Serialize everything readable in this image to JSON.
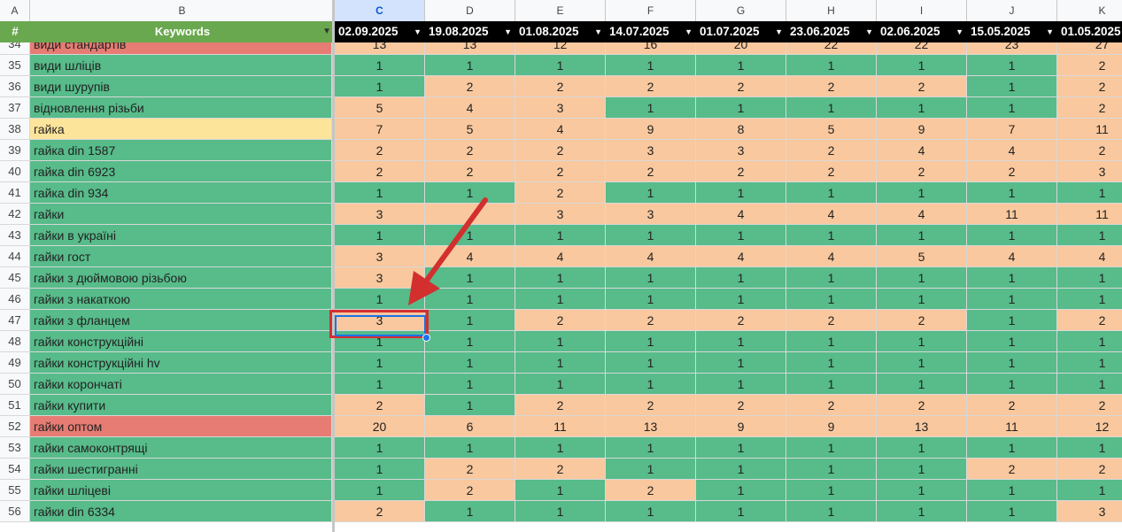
{
  "columns_letters": [
    "A",
    "B",
    "C",
    "D",
    "E",
    "F",
    "G",
    "H",
    "I",
    "J",
    "K"
  ],
  "header": {
    "hash": "#",
    "keywords": "Keywords",
    "dates": [
      "02.09.2025",
      "19.08.2025",
      "01.08.2025",
      "14.07.2025",
      "01.07.2025",
      "23.06.2025",
      "02.06.2025",
      "15.05.2025",
      "01.05.2025"
    ]
  },
  "rows": [
    {
      "n": "34",
      "kw": "види стандартів",
      "kwc": "r",
      "v": [
        "13",
        "13",
        "12",
        "16",
        "20",
        "22",
        "22",
        "23",
        "27"
      ],
      "c": [
        "o",
        "o",
        "o",
        "o",
        "o",
        "o",
        "o",
        "o",
        "o"
      ]
    },
    {
      "n": "35",
      "kw": "види шліців",
      "kwc": "g",
      "v": [
        "1",
        "1",
        "1",
        "1",
        "1",
        "1",
        "1",
        "1",
        "2"
      ],
      "c": [
        "g",
        "g",
        "g",
        "g",
        "g",
        "g",
        "g",
        "g",
        "o"
      ]
    },
    {
      "n": "36",
      "kw": "види шурупів",
      "kwc": "g",
      "v": [
        "1",
        "2",
        "2",
        "2",
        "2",
        "2",
        "2",
        "1",
        "2"
      ],
      "c": [
        "g",
        "o",
        "o",
        "o",
        "o",
        "o",
        "o",
        "g",
        "o"
      ]
    },
    {
      "n": "37",
      "kw": "відновлення різьби",
      "kwc": "g",
      "v": [
        "5",
        "4",
        "3",
        "1",
        "1",
        "1",
        "1",
        "1",
        "2"
      ],
      "c": [
        "o",
        "o",
        "o",
        "g",
        "g",
        "g",
        "g",
        "g",
        "o"
      ]
    },
    {
      "n": "38",
      "kw": "гайка",
      "kwc": "y",
      "v": [
        "7",
        "5",
        "4",
        "9",
        "8",
        "5",
        "9",
        "7",
        "11"
      ],
      "c": [
        "o",
        "o",
        "o",
        "o",
        "o",
        "o",
        "o",
        "o",
        "o"
      ]
    },
    {
      "n": "39",
      "kw": "гайка din 1587",
      "kwc": "g",
      "v": [
        "2",
        "2",
        "2",
        "3",
        "3",
        "2",
        "4",
        "4",
        "2"
      ],
      "c": [
        "o",
        "o",
        "o",
        "o",
        "o",
        "o",
        "o",
        "o",
        "o"
      ]
    },
    {
      "n": "40",
      "kw": "гайка din 6923",
      "kwc": "g",
      "v": [
        "2",
        "2",
        "2",
        "2",
        "2",
        "2",
        "2",
        "2",
        "3"
      ],
      "c": [
        "o",
        "o",
        "o",
        "o",
        "o",
        "o",
        "o",
        "o",
        "o"
      ]
    },
    {
      "n": "41",
      "kw": "гайка din 934",
      "kwc": "g",
      "v": [
        "1",
        "1",
        "2",
        "1",
        "1",
        "1",
        "1",
        "1",
        "1"
      ],
      "c": [
        "g",
        "g",
        "o",
        "g",
        "g",
        "g",
        "g",
        "g",
        "g"
      ]
    },
    {
      "n": "42",
      "kw": "гайки",
      "kwc": "g",
      "v": [
        "3",
        "",
        "3",
        "3",
        "4",
        "4",
        "4",
        "11",
        "11"
      ],
      "c": [
        "o",
        "o",
        "o",
        "o",
        "o",
        "o",
        "o",
        "o",
        "o"
      ]
    },
    {
      "n": "43",
      "kw": "гайки в україні",
      "kwc": "g",
      "v": [
        "1",
        "1",
        "1",
        "1",
        "1",
        "1",
        "1",
        "1",
        "1"
      ],
      "c": [
        "g",
        "g",
        "g",
        "g",
        "g",
        "g",
        "g",
        "g",
        "g"
      ]
    },
    {
      "n": "44",
      "kw": "гайки гост",
      "kwc": "g",
      "v": [
        "3",
        "4",
        "4",
        "4",
        "4",
        "4",
        "5",
        "4",
        "4"
      ],
      "c": [
        "o",
        "o",
        "o",
        "o",
        "o",
        "o",
        "o",
        "o",
        "o"
      ]
    },
    {
      "n": "45",
      "kw": "гайки з дюймовою різьбою",
      "kwc": "g",
      "v": [
        "3",
        "1",
        "1",
        "1",
        "1",
        "1",
        "1",
        "1",
        "1"
      ],
      "c": [
        "o",
        "g",
        "g",
        "g",
        "g",
        "g",
        "g",
        "g",
        "g"
      ]
    },
    {
      "n": "46",
      "kw": "гайки з накаткою",
      "kwc": "g",
      "v": [
        "1",
        "1",
        "1",
        "1",
        "1",
        "1",
        "1",
        "1",
        "1"
      ],
      "c": [
        "g",
        "g",
        "g",
        "g",
        "g",
        "g",
        "g",
        "g",
        "g"
      ]
    },
    {
      "n": "47",
      "kw": "гайки з фланцем",
      "kwc": "g",
      "v": [
        "3",
        "1",
        "2",
        "2",
        "2",
        "2",
        "2",
        "1",
        "2"
      ],
      "c": [
        "o",
        "g",
        "o",
        "o",
        "o",
        "o",
        "o",
        "g",
        "o"
      ]
    },
    {
      "n": "48",
      "kw": "гайки конструкційні",
      "kwc": "g",
      "v": [
        "1",
        "1",
        "1",
        "1",
        "1",
        "1",
        "1",
        "1",
        "1"
      ],
      "c": [
        "g",
        "g",
        "g",
        "g",
        "g",
        "g",
        "g",
        "g",
        "g"
      ]
    },
    {
      "n": "49",
      "kw": "гайки конструкційні hv",
      "kwc": "g",
      "v": [
        "1",
        "1",
        "1",
        "1",
        "1",
        "1",
        "1",
        "1",
        "1"
      ],
      "c": [
        "g",
        "g",
        "g",
        "g",
        "g",
        "g",
        "g",
        "g",
        "g"
      ]
    },
    {
      "n": "50",
      "kw": "гайки корончаті",
      "kwc": "g",
      "v": [
        "1",
        "1",
        "1",
        "1",
        "1",
        "1",
        "1",
        "1",
        "1"
      ],
      "c": [
        "g",
        "g",
        "g",
        "g",
        "g",
        "g",
        "g",
        "g",
        "g"
      ]
    },
    {
      "n": "51",
      "kw": "гайки купити",
      "kwc": "g",
      "v": [
        "2",
        "1",
        "2",
        "2",
        "2",
        "2",
        "2",
        "2",
        "2"
      ],
      "c": [
        "o",
        "g",
        "o",
        "o",
        "o",
        "o",
        "o",
        "o",
        "o"
      ]
    },
    {
      "n": "52",
      "kw": "гайки оптом",
      "kwc": "r",
      "v": [
        "20",
        "6",
        "11",
        "13",
        "9",
        "9",
        "13",
        "11",
        "12"
      ],
      "c": [
        "o",
        "o",
        "o",
        "o",
        "o",
        "o",
        "o",
        "o",
        "o"
      ]
    },
    {
      "n": "53",
      "kw": "гайки самоконтрящі",
      "kwc": "g",
      "v": [
        "1",
        "1",
        "1",
        "1",
        "1",
        "1",
        "1",
        "1",
        "1"
      ],
      "c": [
        "g",
        "g",
        "g",
        "g",
        "g",
        "g",
        "g",
        "g",
        "g"
      ]
    },
    {
      "n": "54",
      "kw": "гайки шестигранні",
      "kwc": "g",
      "v": [
        "1",
        "2",
        "2",
        "1",
        "1",
        "1",
        "1",
        "2",
        "2"
      ],
      "c": [
        "g",
        "o",
        "o",
        "g",
        "g",
        "g",
        "g",
        "o",
        "o"
      ]
    },
    {
      "n": "55",
      "kw": "гайки шліцеві",
      "kwc": "g",
      "v": [
        "1",
        "2",
        "1",
        "2",
        "1",
        "1",
        "1",
        "1",
        "1"
      ],
      "c": [
        "g",
        "o",
        "g",
        "o",
        "g",
        "g",
        "g",
        "g",
        "g"
      ]
    },
    {
      "n": "56",
      "kw": "гайки din 6334",
      "kwc": "g",
      "v": [
        "2",
        "1",
        "1",
        "1",
        "1",
        "1",
        "1",
        "1",
        "3"
      ],
      "c": [
        "o",
        "g",
        "g",
        "g",
        "g",
        "g",
        "g",
        "g",
        "o"
      ]
    }
  ],
  "colors": {
    "green": "#57bb8a",
    "orange": "#f9c89e",
    "red": "#e67c73",
    "yellow": "#fce49a",
    "header_green": "#6aa84f",
    "arrow": "#d32f2f"
  }
}
